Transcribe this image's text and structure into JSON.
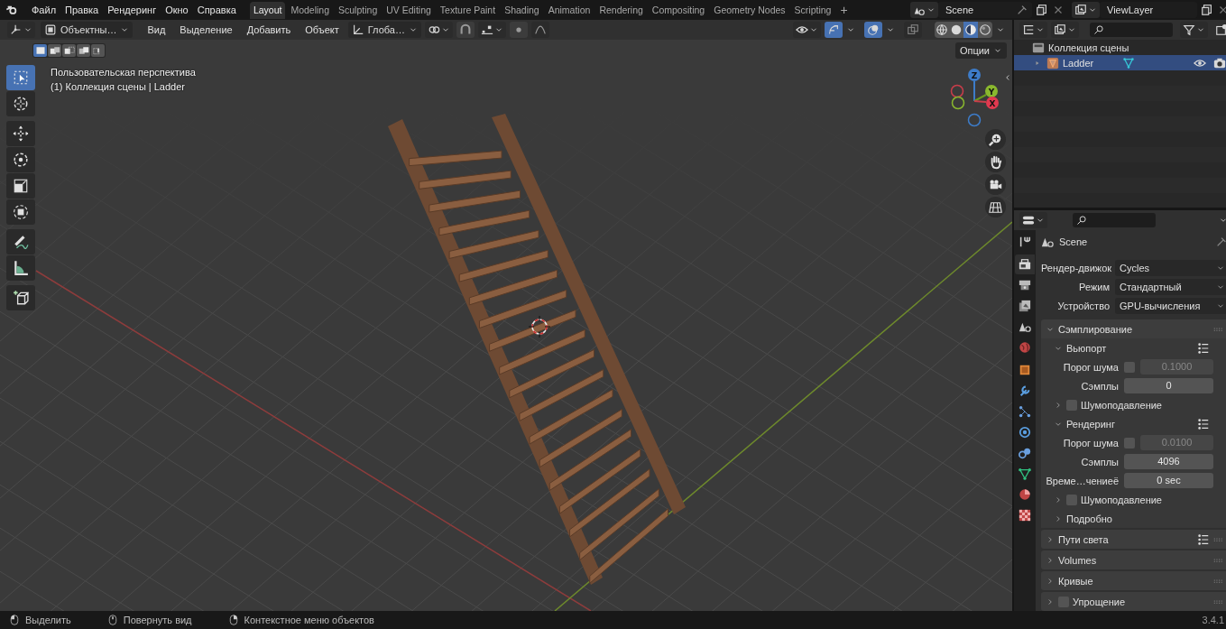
{
  "menu": [
    "Файл",
    "Правка",
    "Рендеринг",
    "Окно",
    "Справка"
  ],
  "workspaces": [
    {
      "label": "Layout",
      "selected": true
    },
    {
      "label": "Modeling",
      "selected": false
    },
    {
      "label": "Sculpting",
      "selected": false
    },
    {
      "label": "UV Editing",
      "selected": false
    },
    {
      "label": "Texture Paint",
      "selected": false
    },
    {
      "label": "Shading",
      "selected": false
    },
    {
      "label": "Animation",
      "selected": false
    },
    {
      "label": "Rendering",
      "selected": false
    },
    {
      "label": "Compositing",
      "selected": false
    },
    {
      "label": "Geometry Nodes",
      "selected": false
    },
    {
      "label": "Scripting",
      "selected": false
    }
  ],
  "add_workspace": "+",
  "scene": "Scene",
  "view_layer": "ViewLayer",
  "viewport_header": {
    "mode": "Объектны…",
    "menus": [
      "Вид",
      "Выделение",
      "Добавить",
      "Объект"
    ],
    "orientation": "Глоба…",
    "options": "Опции"
  },
  "select_modes": [
    {
      "kind": "set",
      "selected": true
    },
    {
      "kind": "extend",
      "selected": false
    },
    {
      "kind": "subtract",
      "selected": false
    },
    {
      "kind": "invert",
      "selected": false
    },
    {
      "kind": "intersect",
      "selected": false
    }
  ],
  "shading": [
    {
      "kind": "wireframe",
      "selected": false
    },
    {
      "kind": "solid",
      "selected": false
    },
    {
      "kind": "material",
      "selected": true
    },
    {
      "kind": "rendered",
      "selected": false
    }
  ],
  "viewport_info": [
    "Пользовательская перспектива",
    "(1) Коллекция сцены | Ladder"
  ],
  "toolbar": [
    {
      "kind": "select",
      "selected": true
    },
    {
      "kind": "cursor",
      "selected": false
    },
    {
      "kind": "move",
      "selected": false
    },
    {
      "kind": "rotate",
      "selected": false
    },
    {
      "kind": "scale",
      "selected": false
    },
    {
      "kind": "transform",
      "selected": false
    },
    {
      "kind": "annotate",
      "selected": false
    },
    {
      "kind": "measure",
      "selected": false
    },
    {
      "kind": "add_cube",
      "selected": false
    }
  ],
  "gizmo_axes": [
    "Z",
    "Y",
    "X"
  ],
  "outliner": [
    {
      "kind": "collection",
      "label": "Коллекция сцены",
      "selected": false
    },
    {
      "kind": "object",
      "label": "Ladder",
      "selected": true
    }
  ],
  "properties": {
    "tabs": [
      {
        "kind": "tool",
        "selected": false
      },
      {
        "kind": "render",
        "selected": true
      },
      {
        "kind": "output",
        "selected": false
      },
      {
        "kind": "view_layer",
        "selected": false
      },
      {
        "kind": "scene",
        "selected": false
      },
      {
        "kind": "world",
        "selected": false
      },
      {
        "kind": "object",
        "selected": false
      },
      {
        "kind": "modifiers",
        "selected": false
      },
      {
        "kind": "particles",
        "selected": false
      },
      {
        "kind": "physics",
        "selected": false
      },
      {
        "kind": "constraints",
        "selected": false
      },
      {
        "kind": "data",
        "selected": false
      },
      {
        "kind": "material",
        "selected": false
      },
      {
        "kind": "texture",
        "selected": false
      }
    ],
    "context": "Scene",
    "fields": [
      {
        "label": "Рендер-движок",
        "value": "Cycles"
      },
      {
        "label": "Режим",
        "value": "Стандартный"
      },
      {
        "label": "Устройство",
        "value": "GPU-вычисления"
      }
    ],
    "panels": [
      {
        "label": "Сэмплирование",
        "expanded": true,
        "children": [
          {
            "label": "Вьюпорт",
            "expanded": true,
            "presets": true,
            "rows": [
              {
                "label": "Порог шума",
                "checked": false,
                "value": "0.1000"
              },
              {
                "label": "Сэмплы",
                "value": "0"
              }
            ],
            "children": [
              {
                "label": "Шумоподавление",
                "expanded": false,
                "checked": false
              }
            ]
          },
          {
            "label": "Рендеринг",
            "expanded": true,
            "presets": true,
            "rows": [
              {
                "label": "Порог шума",
                "checked": false,
                "value": "0.0100"
              },
              {
                "label": "Сэмплы",
                "value": "4096"
              },
              {
                "label": "Време…чениеё",
                "value": "0 sec"
              }
            ],
            "children": [
              {
                "label": "Шумоподавление",
                "expanded": false,
                "checked": false
              }
            ]
          },
          {
            "label": "Подробно",
            "expanded": false
          }
        ]
      },
      {
        "label": "Пути света",
        "expanded": false,
        "presets": true
      },
      {
        "label": "Volumes",
        "expanded": false
      },
      {
        "label": "Кривые",
        "expanded": false
      },
      {
        "label": "Упрощение",
        "expanded": false,
        "checked": false
      }
    ]
  },
  "status_bar": [
    {
      "kind": "mouse_left",
      "label": "Выделить"
    },
    {
      "kind": "mouse_middle",
      "label": "Повернуть вид"
    },
    {
      "kind": "mouse_right",
      "label": "Контекстное меню объектов"
    }
  ],
  "version": "3.4.1"
}
